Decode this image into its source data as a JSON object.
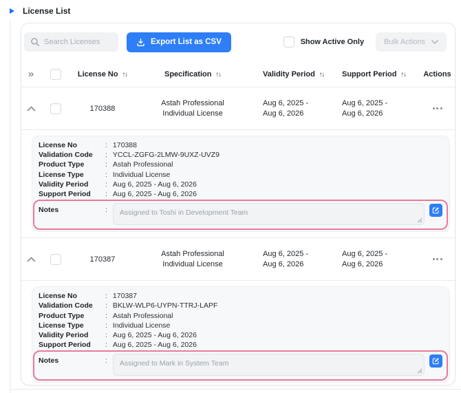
{
  "section": {
    "title": "License List"
  },
  "toolbar": {
    "search_placeholder": "Search Licenses",
    "export_button": "Export List as CSV",
    "show_active_only": "Show Active Only",
    "bulk_actions": "Bulk Actions"
  },
  "table": {
    "expand_all_glyph": "»",
    "sort_glyph": "↑↓",
    "colon": ":",
    "columns": {
      "license_no": "License No",
      "specification": "Specification",
      "validity_period": "Validity Period",
      "support_period": "Support Period",
      "actions": "Actions"
    },
    "rows": [
      {
        "license_no": "170388",
        "specification": [
          "Astah Professional",
          "Individual License"
        ],
        "validity_period": [
          "Aug 6, 2025 -",
          "Aug 6, 2026"
        ],
        "support_period": [
          "Aug 6, 2025 -",
          "Aug 6, 2026"
        ],
        "details": {
          "fields": [
            {
              "label": "License No",
              "value": "170388"
            },
            {
              "label": "Validation Code",
              "value": "YCCL-ZGFG-2LMW-9UXZ-UVZ9"
            },
            {
              "label": "Product Type",
              "value": "Astah Professional"
            },
            {
              "label": "License Type",
              "value": "Individual License"
            },
            {
              "label": "Validity Period",
              "value": "Aug 6, 2025 - Aug 6, 2026"
            },
            {
              "label": "Support Period",
              "value": "Aug 6, 2025 - Aug 6, 2026"
            }
          ],
          "notes": {
            "label": "Notes",
            "value": "Assigned to Toshi in Development Team"
          }
        }
      },
      {
        "license_no": "170387",
        "specification": [
          "Astah Professional",
          "Individual License"
        ],
        "validity_period": [
          "Aug 6, 2025 -",
          "Aug 6, 2026"
        ],
        "support_period": [
          "Aug 6, 2025 -",
          "Aug 6, 2026"
        ],
        "details": {
          "fields": [
            {
              "label": "License No",
              "value": "170387"
            },
            {
              "label": "Validation Code",
              "value": "BKLW-WLP6-UYPN-TTRJ-LAPF"
            },
            {
              "label": "Product Type",
              "value": "Astah Professional"
            },
            {
              "label": "License Type",
              "value": "Individual License"
            },
            {
              "label": "Validity Period",
              "value": "Aug 6, 2025 - Aug 6, 2026"
            },
            {
              "label": "Support Period",
              "value": "Aug 6, 2025 - Aug 6, 2026"
            }
          ],
          "notes": {
            "label": "Notes",
            "value": "Assigned to Mark in System Team"
          }
        }
      }
    ]
  },
  "icons": {
    "section-toggle-icon": "triangle-right",
    "search-icon": "magnifier",
    "export-icon": "download-tray",
    "bulk-chevron-icon": "chevron-down",
    "expand-all-icon": "double-chevron-right",
    "collapse-row-icon": "chevron-up",
    "row-actions-icon": "ellipsis-horizontal",
    "notes-edit-icon": "pencil-square",
    "resize-grip-icon": "diagonal-grip"
  },
  "colors": {
    "accent_blue": "#2d7ef7",
    "triangle_blue": "#1e6ef5",
    "highlight_pink": "#e87a9b"
  }
}
